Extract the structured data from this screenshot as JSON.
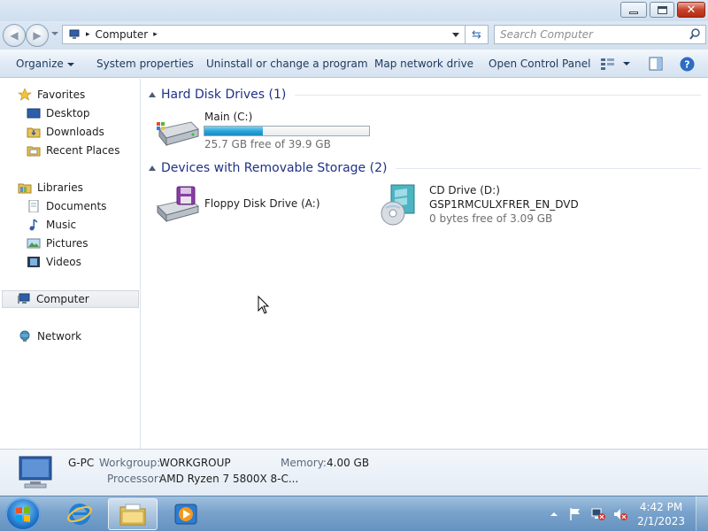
{
  "window": {
    "controls": [
      "minimize-icon",
      "maximize-icon",
      "close-icon"
    ]
  },
  "address_bar": {
    "location": "Computer",
    "separator_glyph": "▸"
  },
  "search": {
    "placeholder": "Search Computer"
  },
  "toolbar": {
    "organize": "Organize",
    "system_properties": "System properties",
    "uninstall": "Uninstall or change a program",
    "map_drive": "Map network drive",
    "control_panel": "Open Control Panel"
  },
  "sidebar": {
    "favorites": {
      "label": "Favorites",
      "items": [
        {
          "label": "Desktop",
          "icon": "desktop-icon"
        },
        {
          "label": "Downloads",
          "icon": "downloads-icon"
        },
        {
          "label": "Recent Places",
          "icon": "recent-places-icon"
        }
      ]
    },
    "libraries": {
      "label": "Libraries",
      "items": [
        {
          "label": "Documents",
          "icon": "documents-icon"
        },
        {
          "label": "Music",
          "icon": "music-icon"
        },
        {
          "label": "Pictures",
          "icon": "pictures-icon"
        },
        {
          "label": "Videos",
          "icon": "videos-icon"
        }
      ]
    },
    "computer": "Computer",
    "network": "Network"
  },
  "groups": {
    "hdd": {
      "title": "Hard Disk Drives (1)",
      "drives": [
        {
          "name": "Main (C:)",
          "free": "25.7 GB free of 39.9 GB",
          "used_fraction": 0.356
        }
      ]
    },
    "removable": {
      "title": "Devices with Removable Storage (2)",
      "drives": [
        {
          "name": "Floppy Disk Drive (A:)"
        },
        {
          "name": "CD Drive (D:)",
          "label": "GSP1RMCULXFRER_EN_DVD",
          "free": "0 bytes free of 3.09 GB"
        }
      ]
    }
  },
  "details": {
    "pc_name": "G-PC",
    "workgroup_label": "Workgroup:",
    "workgroup_value": "WORKGROUP",
    "memory_label": "Memory:",
    "memory_value": "4.00 GB",
    "processor_label": "Processor:",
    "processor_value": "AMD Ryzen 7 5800X 8-C..."
  },
  "taskbar": {
    "time": "4:42 PM",
    "date": "2/1/2023"
  },
  "colors": {
    "group_title": "#1e3287",
    "usage_fill": "#26a0da"
  }
}
